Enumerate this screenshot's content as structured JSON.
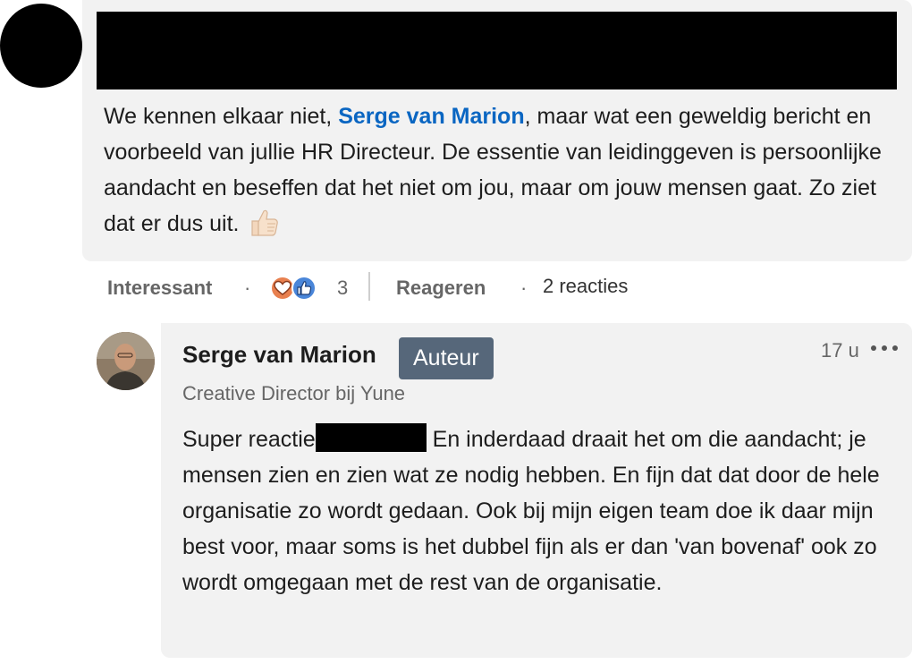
{
  "comment": {
    "text_before_mention": "We kennen elkaar niet, ",
    "mention": "Serge van Marion",
    "text_after_mention": ", maar wat een geweldig bericht en voorbeeld van jullie HR Directeur. De essentie van leidinggeven is persoonlijke aandacht en beseffen dat het niet om jou, maar om jouw mensen gaat. Zo ziet dat er dus uit. ",
    "emoji_icon": "thumbs-up-icon"
  },
  "actions": {
    "interessant_label": "Interessant",
    "separator": "·",
    "reaction_icons": [
      "heart-reaction-icon",
      "like-reaction-icon"
    ],
    "reaction_count": "3",
    "reageren_label": "Reageren",
    "replies_label": "2 reacties"
  },
  "reply": {
    "author": "Serge van Marion",
    "badge": "Auteur",
    "headline": "Creative Director bij Yune",
    "time": "17 u",
    "text_before_redaction": "Super reactie",
    "text_after_redaction": " En inderdaad draait het om die aandacht; je mensen zien en zien wat ze nodig hebben. En fijn dat dat door de hele organisatie zo wordt gedaan. Ook bij mijn eigen team doe ik daar mijn best voor, maar soms is het dubbel fijn als er dan 'van bovenaf' ook zo wordt omgegaan met de rest van de organisatie."
  },
  "colors": {
    "mention": "#0a66c2",
    "bubble_bg": "#f2f2f2",
    "badge_bg": "#56677a",
    "muted_text": "#666666"
  }
}
